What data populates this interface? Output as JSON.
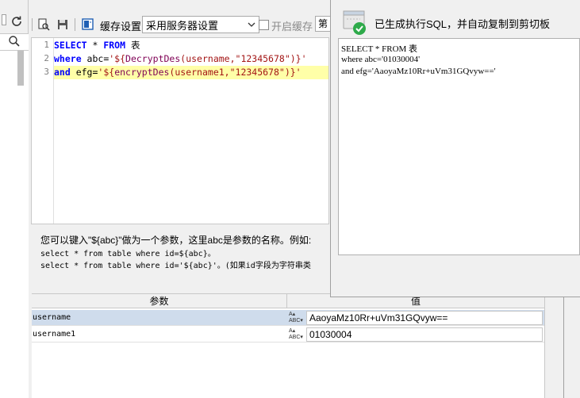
{
  "toolbar": {
    "cache_label": "缓存设置",
    "server_select": "采用服务器设置",
    "enable_cache_label": "开启缓存",
    "partial_button": "第"
  },
  "editor": {
    "line_numbers": [
      "1",
      "2",
      "3"
    ],
    "lines": [
      {
        "kw1": "SELECT",
        "rest": " * ",
        "kw2": "FROM",
        "tail": " 表"
      },
      {
        "kw1": "where",
        "pre": " abc=",
        "str1": "'${",
        "fn": "DecryptDes",
        "str2": "(username,\"12345678\")}'"
      },
      {
        "kw1": "and",
        "pre": " efg=",
        "str1": "'${",
        "fn": "encryptDes",
        "str2": "(username1,\"12345678\")}'"
      }
    ]
  },
  "help": {
    "line1": "您可以键入\"${abc}\"做为一个参数，这里abc是参数的名称。例如:",
    "line2": "select * from table where id=${abc}。",
    "line3": "select * from table where id='${abc}'。(如果id字段为字符串类"
  },
  "params": {
    "header_param": "参数",
    "header_value": "值",
    "rows": [
      {
        "name": "username",
        "type": "ABC",
        "value": "AaoyaMz10Rr+uVm31GQvyw=="
      },
      {
        "name": "username1",
        "type": "ABC",
        "value": "01030004"
      }
    ]
  },
  "popup": {
    "message": "已生成执行SQL，并自动复制到剪切板",
    "sql_lines": [
      "SELECT * FROM 表",
      "where abc='01030004'",
      "and efg='AaoyaMz10Rr+uVm31GQvyw=='"
    ]
  }
}
